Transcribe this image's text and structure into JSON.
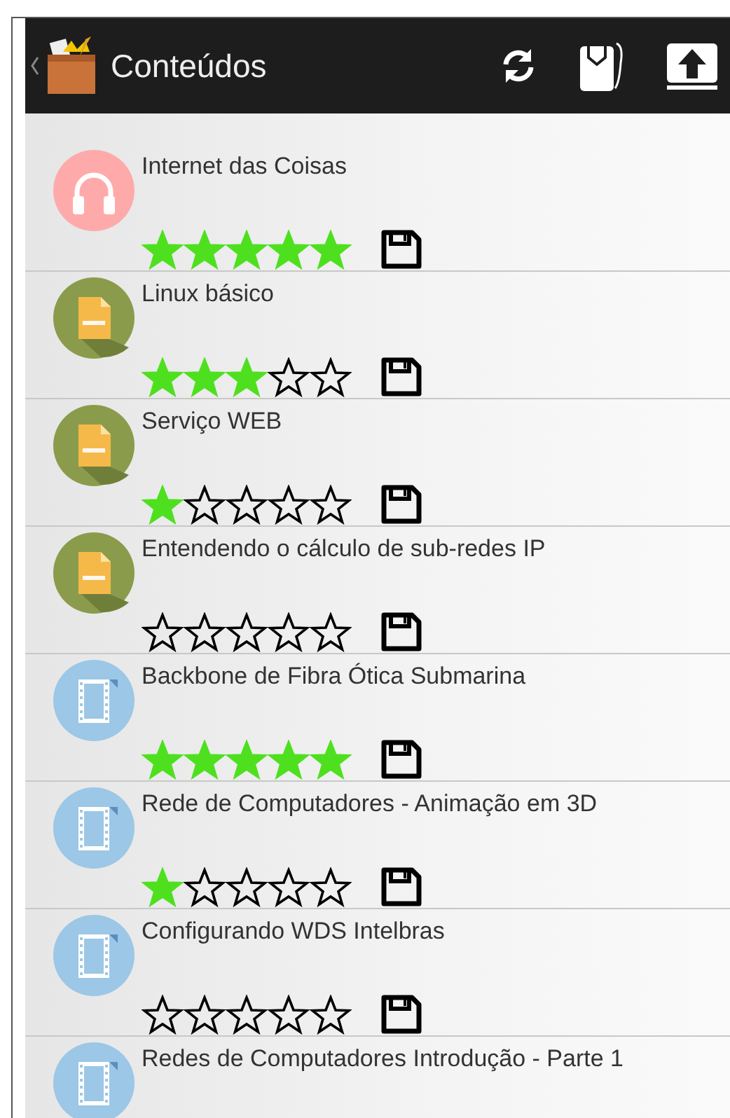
{
  "header": {
    "title": "Conteúdos"
  },
  "items": [
    {
      "title": "Internet das Coisas",
      "kind": "audio",
      "stars": 5
    },
    {
      "title": "Linux básico",
      "kind": "text",
      "stars": 3
    },
    {
      "title": "Serviço WEB",
      "kind": "text",
      "stars": 1
    },
    {
      "title": "Entendendo o cálculo de sub-redes IP",
      "kind": "text",
      "stars": 0
    },
    {
      "title": "Backbone de Fibra Ótica Submarina",
      "kind": "video",
      "stars": 5
    },
    {
      "title": "Rede de Computadores - Animação em 3D",
      "kind": "video",
      "stars": 1
    },
    {
      "title": "Configurando WDS Intelbras",
      "kind": "video",
      "stars": 0
    },
    {
      "title": "Redes de Computadores Introdução - Parte 1",
      "kind": "video"
    }
  ]
}
